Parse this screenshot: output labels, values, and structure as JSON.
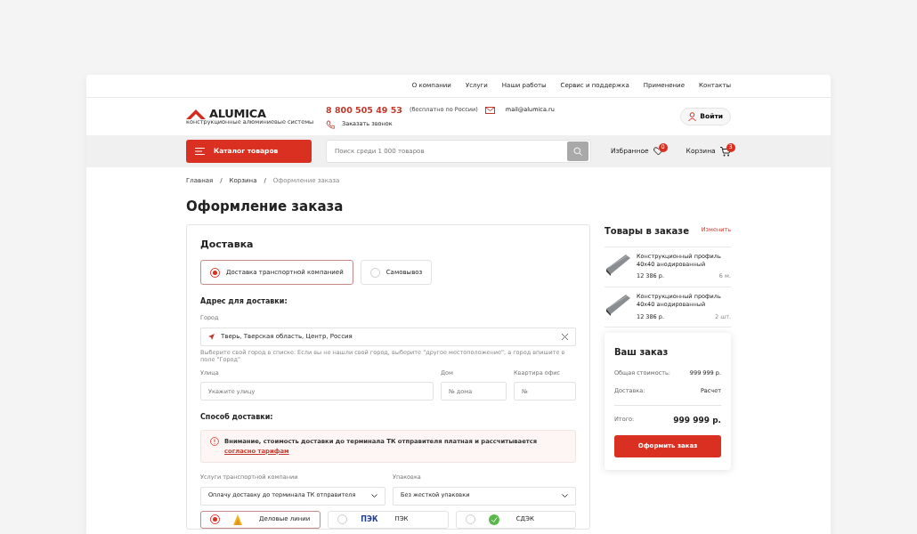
{
  "top_nav": [
    {
      "label": "О компании"
    },
    {
      "label": "Услуги"
    },
    {
      "label": "Наши работы"
    },
    {
      "label": "Сервис и поддержка"
    },
    {
      "label": "Применение"
    },
    {
      "label": "Контакты"
    }
  ],
  "header": {
    "logo_text": "ALUMICA",
    "logo_tagline": "конструкционные алюминиевые системы",
    "phone": "8 800 505 49 53",
    "phone_note": "(бесплатно по России)",
    "email": "mail@alumica.ru",
    "callback": "Заказать звонок",
    "login": "Войти"
  },
  "toolbar": {
    "catalog": "Каталог товаров",
    "search": {
      "placeholder": "Поиск среди 1 000 товаров"
    },
    "favorites": {
      "label": "Избранное",
      "count": "0"
    },
    "cart": {
      "label": "Корзина",
      "count": "3"
    }
  },
  "breadcrumbs": [
    "Главная",
    "Корзина",
    "Оформление заказа"
  ],
  "breadcrumb_separator": "/",
  "page_title": "Оформление заказа",
  "delivery": {
    "title": "Доставка",
    "types": [
      {
        "label": "Доставка транспортной компанией",
        "selected": true
      },
      {
        "label": "Самовывоз",
        "selected": false
      }
    ],
    "address_title": "Адрес для доставки:",
    "city": {
      "label": "Город",
      "value": "Тверь, Тверская область, Центр, Россия",
      "hint": "Выберите свой город в списке. Если вы не нашли свой город, выберите \"другое местоположение\", а город впишите в поле \"Город\""
    },
    "street": {
      "label": "Улица",
      "placeholder": "Укажите улицу"
    },
    "house": {
      "label": "Дом",
      "placeholder": "№ дома"
    },
    "apartment": {
      "label": "Квартира офис",
      "placeholder": "№"
    },
    "method_title": "Способ доставки:",
    "notice": {
      "text": "Внимание, стоимость доставки до терминала ТК отправителя платная и рассчитывается",
      "link": "согласно тарифам"
    },
    "services": {
      "label": "Услуги транспортной компании",
      "value": "Оплачу доставку до терминала ТК отправителя"
    },
    "packing": {
      "label": "Упаковка",
      "value": "Без жесткой упаковки"
    },
    "carriers": [
      {
        "name": "Деловые линии",
        "selected": true,
        "kind": "flame"
      },
      {
        "name": "ПЭК",
        "selected": false,
        "kind": "wordmark",
        "logo_text": "ПЭК"
      },
      {
        "name": "СДЭК",
        "selected": false,
        "kind": "circle"
      }
    ]
  },
  "order_items": {
    "title": "Товары в заказе",
    "edit": "Изменить",
    "items": [
      {
        "name": "Конструкционный профиль 40х40 анодированный",
        "price": "12 386 р.",
        "qty": "6 м."
      },
      {
        "name": "Конструкционный профиль 40х40 анодированный",
        "price": "12 386 р.",
        "qty": "2 шт."
      }
    ]
  },
  "summary": {
    "title": "Ваш заказ",
    "rows": [
      {
        "label": "Общая стоимость:",
        "value": "999 999 р."
      },
      {
        "label": "Доставка:",
        "value": "Расчет"
      }
    ],
    "total_label": "Итого:",
    "total_value": "999 999 р.",
    "button": "Оформить заказ"
  }
}
